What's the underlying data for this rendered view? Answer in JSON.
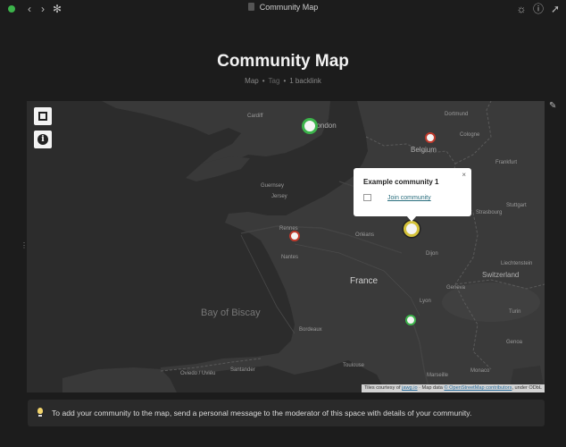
{
  "window": {
    "title": "Community Map",
    "icons": [
      "back-icon",
      "forward-icon",
      "graph-icon",
      "globe-icon",
      "info-icon",
      "pin-icon"
    ]
  },
  "page": {
    "title": "Community Map",
    "meta": {
      "type": "Map",
      "tag": "Tag",
      "backlinks": "1 backlink"
    }
  },
  "map": {
    "labels": {
      "london": "London",
      "cardiff": "Cardiff",
      "belgium": "Belgium",
      "dortmund": "Dortmund",
      "cologne": "Cologne",
      "frankfurt": "Frankfurt",
      "stuttgart": "Stuttgart",
      "strasbourg": "Strasbourg",
      "liechtenstein": "Liechtenstein",
      "switzerland": "Switzerland",
      "geneva": "Geneva",
      "lyon": "Lyon",
      "turin": "Turin",
      "genoa": "Genoa",
      "monaco": "Monaco",
      "marseille": "Marseille",
      "toulouse": "Toulouse",
      "bordeaux": "Bordeaux",
      "nantes": "Nantes",
      "rennes": "Rennes",
      "orleans": "Orléans",
      "dijon": "Dijon",
      "france": "France",
      "bay": "Bay of Biscay",
      "guernsey": "Guernsey",
      "jersey": "Jersey",
      "santander": "Santander",
      "oviedo": "Oviedo / Uviéu"
    },
    "popup": {
      "title": "Example community 1",
      "link": "Join community",
      "close": "×"
    },
    "attribution": {
      "prefix": "Tiles courtesy of",
      "jawg": "jawg.io",
      "mid": "· Map data",
      "osm": "© OpenStreetMap contributors",
      "suffix": ", under ODbL"
    },
    "colors": {
      "green": "#3cb44b",
      "red": "#c0392b",
      "yellow": "#d4c23a"
    }
  },
  "notice": {
    "text": "To add your community to the map, send a personal message to the moderator of this space with details of your community."
  }
}
